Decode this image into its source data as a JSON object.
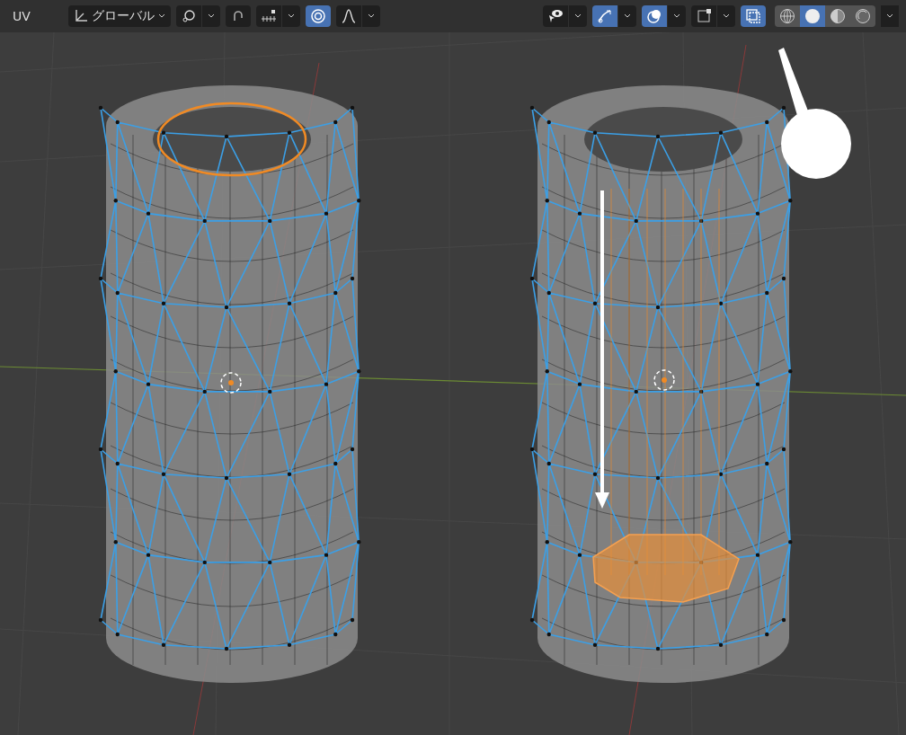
{
  "header": {
    "menu": "UV",
    "orientation": "グローバル",
    "left_tools": [
      {
        "kind": "pivot",
        "on": false
      },
      {
        "kind": "snap",
        "on": false
      },
      {
        "kind": "increment",
        "on": false
      },
      {
        "kind": "proportional",
        "on": true
      },
      {
        "kind": "falloff",
        "on": false
      }
    ],
    "right_tools": [
      {
        "kind": "visibility",
        "on": false
      },
      {
        "kind": "gizmo",
        "on": true
      },
      {
        "kind": "overlay",
        "on": true
      },
      {
        "kind": "mesh-overlay",
        "on": false
      },
      {
        "kind": "xray",
        "on": true
      }
    ],
    "shading": [
      {
        "kind": "wireframe",
        "selected": false
      },
      {
        "kind": "solid",
        "selected": true
      },
      {
        "kind": "material",
        "selected": false
      },
      {
        "kind": "rendered",
        "selected": false
      }
    ]
  }
}
